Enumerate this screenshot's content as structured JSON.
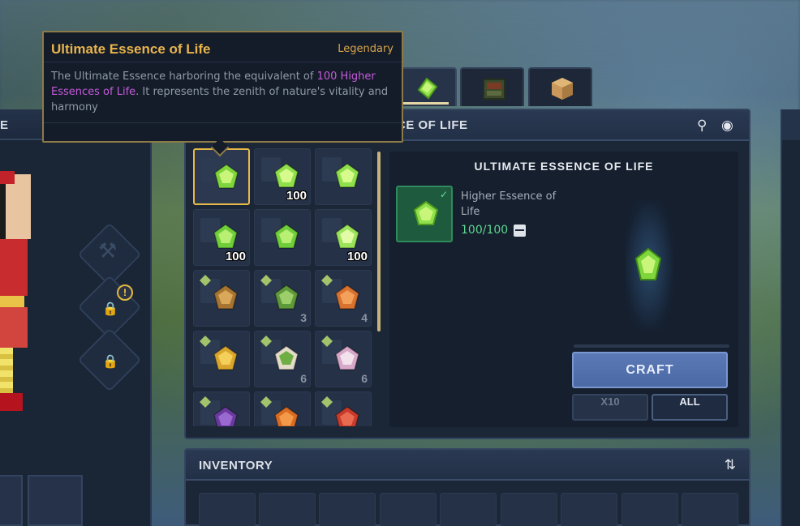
{
  "tooltip": {
    "name": "Ultimate Essence of Life",
    "rarity": "Legendary",
    "desc_before": "The Ultimate Essence harboring the equivalent of ",
    "desc_highlight": "100 Higher Essences of Life",
    "desc_after": ". It represents the zenith of nature's vitality and harmony",
    "name_color": "#e9b44c",
    "highlight_color": "#c55ad9"
  },
  "character_panel": {
    "header_title": "E",
    "slots": [
      "hammer-slot",
      "locked-slot",
      "locked-slot"
    ],
    "alert_badge": "!"
  },
  "tabs": [
    {
      "icon": "essence-icon",
      "active": true
    },
    {
      "icon": "composter-icon",
      "active": false
    },
    {
      "icon": "wood-block-icon",
      "active": false
    }
  ],
  "craft": {
    "header_title": "CE OF LIFE",
    "grid": [
      {
        "icon": "ultimate-essence-icon",
        "qty": "",
        "selected": true
      },
      {
        "icon": "higher-essence-icon",
        "qty": "100",
        "selected": false
      },
      {
        "icon": "higher-essence-icon",
        "qty": "",
        "selected": false
      },
      {
        "icon": "essence-icon",
        "qty": "100",
        "selected": false
      },
      {
        "icon": "essence-icon",
        "qty": "",
        "selected": false
      },
      {
        "icon": "lesser-essence-icon",
        "qty": "100",
        "selected": false
      },
      {
        "icon": "wheat-icon",
        "qty": "",
        "selected": false
      },
      {
        "icon": "lettuce-icon",
        "qty": "3",
        "selected": false
      },
      {
        "icon": "carrot-icon",
        "qty": "4",
        "selected": false
      },
      {
        "icon": "corn-icon",
        "qty": "",
        "selected": false
      },
      {
        "icon": "cauliflower-icon",
        "qty": "6",
        "selected": false
      },
      {
        "icon": "turnip-icon",
        "qty": "6",
        "selected": false
      },
      {
        "icon": "eggplant-icon",
        "qty": "",
        "selected": false
      },
      {
        "icon": "pumpkin-icon",
        "qty": "",
        "selected": false
      },
      {
        "icon": "tomato-icon",
        "qty": "",
        "selected": false
      }
    ],
    "detail": {
      "title": "ULTIMATE ESSENCE OF LIFE",
      "ingredient_name": "Higher Essence of Life",
      "ingredient_count": "100/100",
      "ingredient_check": "✓"
    },
    "craft_label": "CRAFT",
    "x10_label": "X10",
    "all_label": "ALL"
  },
  "inventory": {
    "title": "INVENTORY"
  },
  "colors": {
    "accent_gold": "#e7b949",
    "craft_button": "#5a79b5",
    "success_green": "#5ed68f"
  }
}
